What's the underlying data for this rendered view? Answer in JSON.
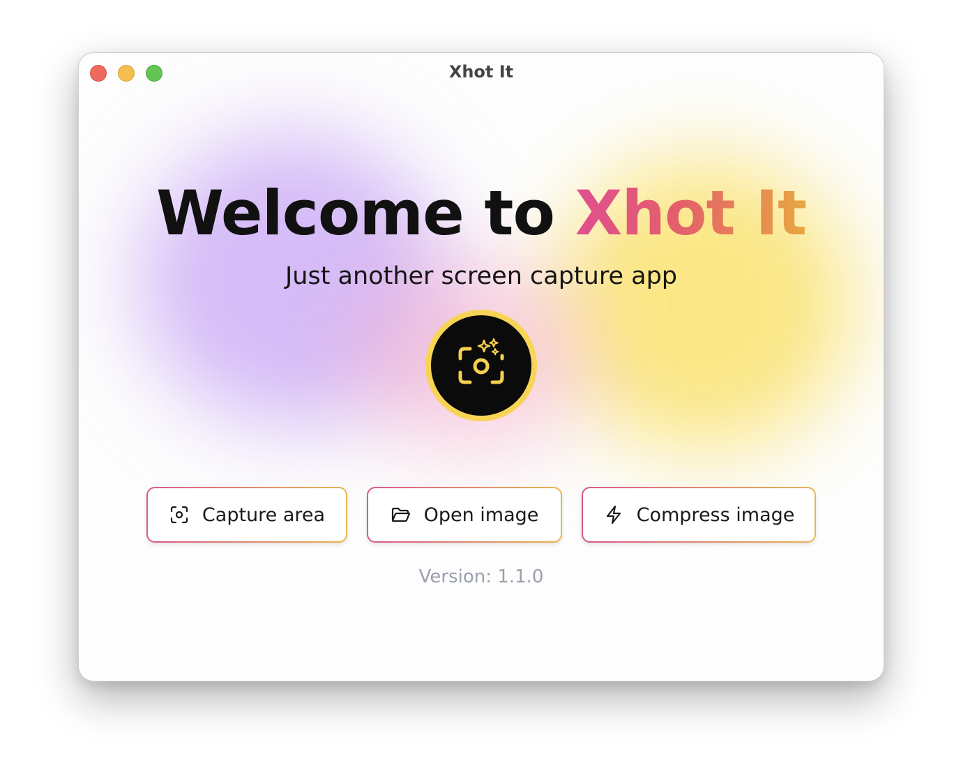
{
  "window": {
    "title": "Xhot It"
  },
  "hero": {
    "headline_prefix": "Welcome to ",
    "headline_brand": "Xhot It",
    "subtitle": "Just another screen capture app",
    "logo_icon": "camera-sparkle-icon"
  },
  "actions": [
    {
      "label": "Capture area",
      "icon": "capture-area-icon"
    },
    {
      "label": "Open image",
      "icon": "folder-open-icon"
    },
    {
      "label": "Compress image",
      "icon": "lightning-icon"
    }
  ],
  "footer": {
    "version": "Version: 1.1.0"
  },
  "colors": {
    "brand_gradient_start": "#df4f8f",
    "brand_gradient_end": "#e7a742",
    "logo_ring": "#f7d456",
    "logo_bg": "#0b0b0b",
    "traffic_close": "#ee6a5e",
    "traffic_minimize": "#f5be4f",
    "traffic_zoom": "#62c554",
    "version_text": "#9aa0aa"
  }
}
